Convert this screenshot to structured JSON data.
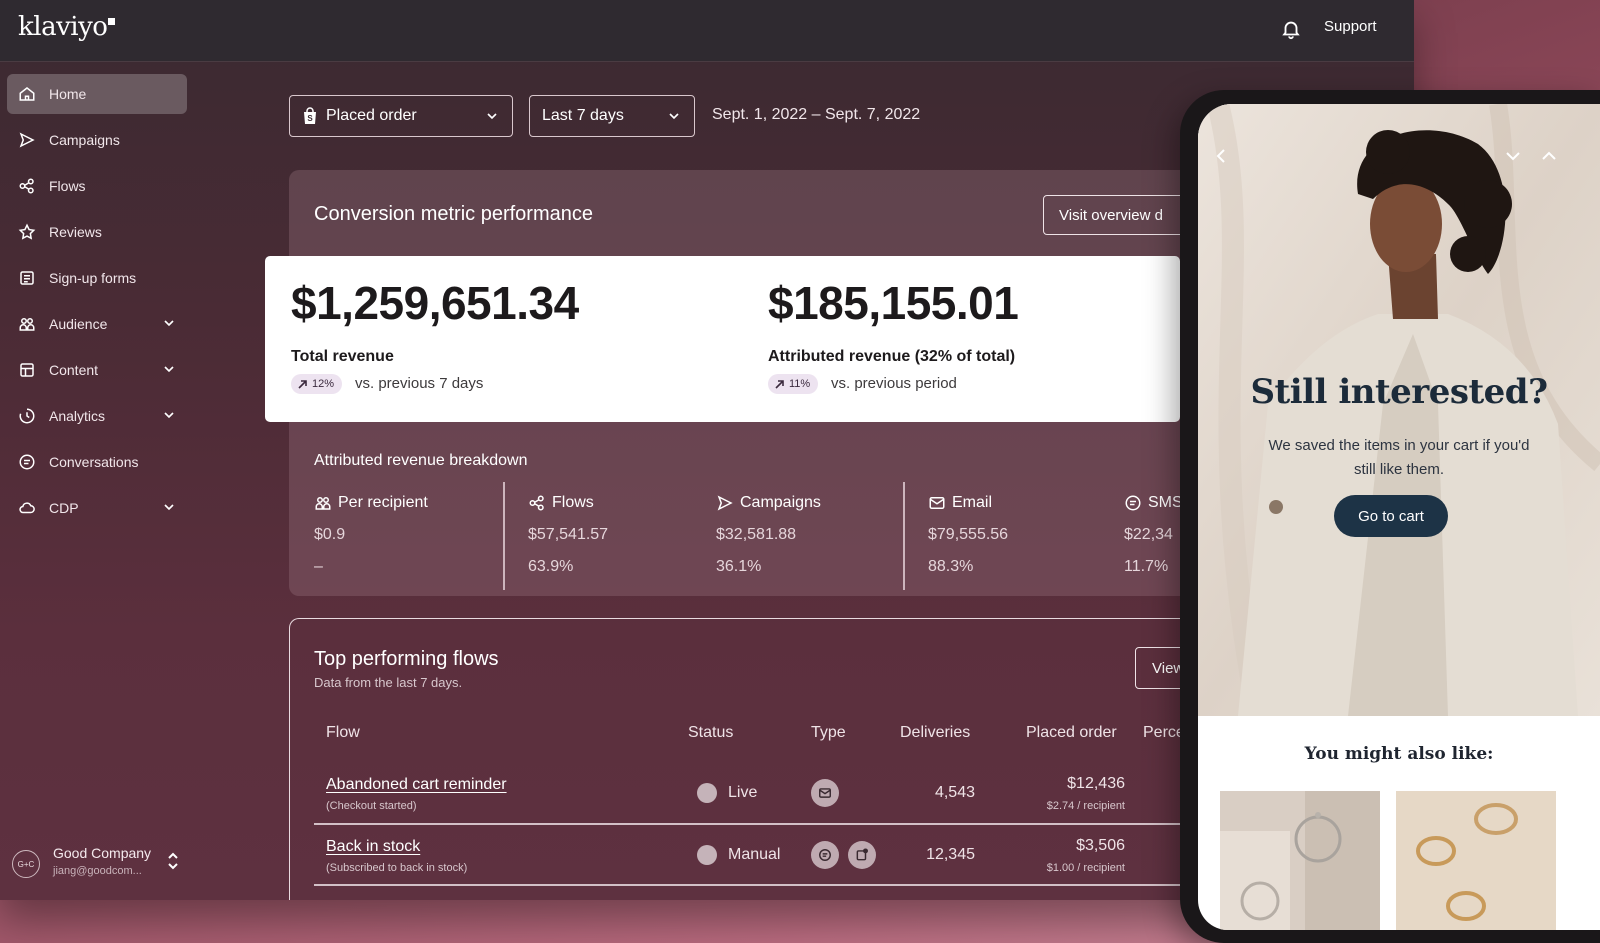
{
  "app": {
    "logo": "klaviyo",
    "support": "Support"
  },
  "sidebar": {
    "items": [
      {
        "label": "Home",
        "icon": "home-icon",
        "active": true,
        "expandable": false
      },
      {
        "label": "Campaigns",
        "icon": "send-icon",
        "expandable": false
      },
      {
        "label": "Flows",
        "icon": "flows-icon",
        "expandable": false
      },
      {
        "label": "Reviews",
        "icon": "star-icon",
        "expandable": false
      },
      {
        "label": "Sign-up forms",
        "icon": "form-icon",
        "expandable": false
      },
      {
        "label": "Audience",
        "icon": "audience-icon",
        "expandable": true
      },
      {
        "label": "Content",
        "icon": "content-icon",
        "expandable": true
      },
      {
        "label": "Analytics",
        "icon": "analytics-icon",
        "expandable": true
      },
      {
        "label": "Conversations",
        "icon": "chat-icon",
        "expandable": false
      },
      {
        "label": "CDP",
        "icon": "cloud-icon",
        "expandable": true
      }
    ],
    "account": {
      "avatar": "G+C",
      "name": "Good Company",
      "email": "jiang@goodcom..."
    }
  },
  "filters": {
    "metric": "Placed order",
    "period": "Last 7 days",
    "date_range": "Sept. 1, 2022 – Sept. 7, 2022"
  },
  "conversion": {
    "title": "Conversion metric performance",
    "visit_button": "Visit overview d",
    "total": {
      "value": "$1,259,651.34",
      "label": "Total revenue",
      "delta": "12%",
      "compare": "vs. previous 7 days"
    },
    "attributed": {
      "value": "$185,155.01",
      "label": "Attributed revenue (32% of total)",
      "delta": "11%",
      "compare": "vs. previous period"
    },
    "breakdown_title": "Attributed revenue breakdown",
    "breakdown": [
      {
        "label": "Per recipient",
        "value": "$0.9",
        "pct": "–"
      },
      {
        "label": "Flows",
        "value": "$57,541.57",
        "pct": "63.9%"
      },
      {
        "label": "Campaigns",
        "value": "$32,581.88",
        "pct": "36.1%"
      },
      {
        "label": "Email",
        "value": "$79,555.56",
        "pct": "88.3%"
      },
      {
        "label": "SMS",
        "value": "$22,34",
        "pct": "11.7%"
      }
    ]
  },
  "flows": {
    "title": "Top performing flows",
    "subtitle": "Data from the last 7 days.",
    "view_button": "View",
    "columns": [
      "Flow",
      "Status",
      "Type",
      "Deliveries",
      "Placed order",
      "Perce"
    ],
    "rows": [
      {
        "name": "Abandoned cart reminder",
        "trigger": "(Checkout started)",
        "status": "Live",
        "types": [
          "email-icon"
        ],
        "deliveries": "4,543",
        "placed": "$12,436",
        "per_recipient": "$2.74 / recipient"
      },
      {
        "name": "Back in stock",
        "trigger": "(Subscribed to back in stock)",
        "status": "Manual",
        "types": [
          "sms-icon",
          "push-icon"
        ],
        "deliveries": "12,345",
        "placed": "$3,506",
        "per_recipient": "$1.00 / recipient"
      }
    ]
  },
  "phone": {
    "headline": "Still interested?",
    "body": "We saved the items in your cart if you'd still like them.",
    "cta": "Go to cart",
    "recommend": "You might also like:"
  }
}
